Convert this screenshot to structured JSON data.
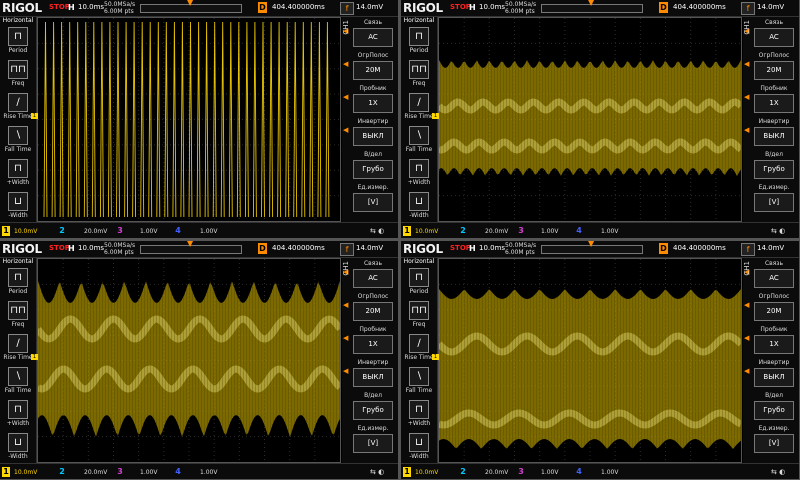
{
  "panels": [
    {
      "wave": "pulse",
      "topbar": {
        "logo": "RIGOL",
        "state": "STOP",
        "h_label": "H",
        "h_value": "10.0ms",
        "sample_rate": "50.0MSa/s",
        "mem_depth": "6.00M pts",
        "d_label": "D",
        "d_value": "404.400000ms",
        "trigger_label": "f",
        "trigger_value": "14.0mV"
      },
      "leftmenu": {
        "header": "Horizontal",
        "items": [
          "Period",
          "Freq",
          "Rise Time",
          "Fall Time",
          "+Width",
          "-Width"
        ]
      },
      "rightmenu": {
        "channel": "CH1",
        "items": [
          {
            "title": "Связь",
            "value": "AC"
          },
          {
            "title": "ОгрПолос",
            "value": "20M"
          },
          {
            "title": "Пробник",
            "value": "1X"
          },
          {
            "title": "Инвертир",
            "value": "ВЫКЛ"
          },
          {
            "title": "В/дел",
            "value": "Грубо"
          },
          {
            "title": "Ед.измер.",
            "value": "[V]"
          }
        ]
      },
      "bottombar": {
        "ch1": "10.0mV",
        "ch2": "20.0mV",
        "ch3": "1.00V",
        "ch4": "1.00V"
      }
    },
    {
      "wave": "band1",
      "topbar": {
        "logo": "RIGOL",
        "state": "STOP",
        "h_label": "H",
        "h_value": "10.0ms",
        "sample_rate": "50.0MSa/s",
        "mem_depth": "6.00M pts",
        "d_label": "D",
        "d_value": "404.400000ms",
        "trigger_label": "f",
        "trigger_value": "14.0mV"
      },
      "leftmenu": {
        "header": "Horizontal",
        "items": [
          "Period",
          "Freq",
          "Rise Time",
          "Fall Time",
          "+Width",
          "-Width"
        ]
      },
      "rightmenu": {
        "channel": "CH1",
        "items": [
          {
            "title": "Связь",
            "value": "AC"
          },
          {
            "title": "ОгрПолос",
            "value": "20M"
          },
          {
            "title": "Пробник",
            "value": "1X"
          },
          {
            "title": "Инвертир",
            "value": "ВЫКЛ"
          },
          {
            "title": "В/дел",
            "value": "Грубо"
          },
          {
            "title": "Ед.измер.",
            "value": "[V]"
          }
        ]
      },
      "bottombar": {
        "ch1": "10.0mV",
        "ch2": "20.0mV",
        "ch3": "1.00V",
        "ch4": "1.00V"
      }
    },
    {
      "wave": "band2",
      "topbar": {
        "logo": "RIGOL",
        "state": "STOP",
        "h_label": "H",
        "h_value": "10.0ms",
        "sample_rate": "50.0MSa/s",
        "mem_depth": "6.00M pts",
        "d_label": "D",
        "d_value": "404.400000ms",
        "trigger_label": "f",
        "trigger_value": "14.0mV"
      },
      "leftmenu": {
        "header": "Horizontal",
        "items": [
          "Period",
          "Freq",
          "Rise Time",
          "Fall Time",
          "+Width",
          "-Width"
        ]
      },
      "rightmenu": {
        "channel": "CH1",
        "items": [
          {
            "title": "Связь",
            "value": "AC"
          },
          {
            "title": "ОгрПолос",
            "value": "20M"
          },
          {
            "title": "Пробник",
            "value": "1X"
          },
          {
            "title": "Инвертир",
            "value": "ВЫКЛ"
          },
          {
            "title": "В/дел",
            "value": "Грубо"
          },
          {
            "title": "Ед.измер.",
            "value": "[V]"
          }
        ]
      },
      "bottombar": {
        "ch1": "10.0mV",
        "ch2": "20.0mV",
        "ch3": "1.00V",
        "ch4": "1.00V"
      }
    },
    {
      "wave": "band3",
      "topbar": {
        "logo": "RIGOL",
        "state": "STOP",
        "h_label": "H",
        "h_value": "10.0ms",
        "sample_rate": "50.0MSa/s",
        "mem_depth": "6.00M pts",
        "d_label": "D",
        "d_value": "404.400000ms",
        "trigger_label": "f",
        "trigger_value": "14.0mV"
      },
      "leftmenu": {
        "header": "Horizontal",
        "items": [
          "Period",
          "Freq",
          "Rise Time",
          "Fall Time",
          "+Width",
          "-Width"
        ]
      },
      "rightmenu": {
        "channel": "CH1",
        "items": [
          {
            "title": "Связь",
            "value": "AC"
          },
          {
            "title": "ОгрПолос",
            "value": "20M"
          },
          {
            "title": "Пробник",
            "value": "1X"
          },
          {
            "title": "Инвертир",
            "value": "ВЫКЛ"
          },
          {
            "title": "В/дел",
            "value": "Грубо"
          },
          {
            "title": "Ед.измер.",
            "value": "[V]"
          }
        ]
      },
      "bottombar": {
        "ch1": "10.0mV",
        "ch2": "20.0mV",
        "ch3": "1.00V",
        "ch4": "1.00V"
      }
    }
  ],
  "colors": {
    "ch1": "#ffd800",
    "ch2": "#00c8ff",
    "ch3": "#d040d0",
    "ch4": "#4060ff",
    "accent": "#ff8c00"
  }
}
